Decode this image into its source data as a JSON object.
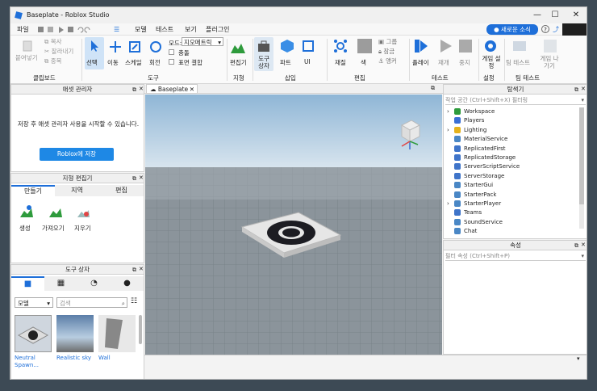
{
  "window": {
    "title": "Baseplate - Roblox Studio"
  },
  "menu": {
    "file": "파일",
    "items": [
      "모델",
      "테스트",
      "보기",
      "플러그인"
    ],
    "news_label": "새로운 소식"
  },
  "ribbon": {
    "clipboard": {
      "paste": "붙여넣기",
      "copy": "복사",
      "cut": "잘라내기",
      "duplicate": "중복",
      "group": "클립보드"
    },
    "tools": {
      "select": "선택",
      "move": "이동",
      "scale": "스케일",
      "rotate": "회전",
      "mode_label": "모드:",
      "mode_value": "지오메트릭",
      "collisions": "충돌",
      "surface_join": "표면 결합",
      "group": "도구"
    },
    "terrain": {
      "editor": "편집기",
      "group": "지형"
    },
    "insert": {
      "toolbox": "도구 상자",
      "part": "파트",
      "ui": "UI",
      "group": "삽입"
    },
    "edit": {
      "material": "재질",
      "color": "색",
      "group_item": "그룹",
      "lock": "잠금",
      "anchor": "앵커",
      "group": "편집"
    },
    "test": {
      "play": "플레이",
      "resume": "재개",
      "stop": "중지",
      "group": "테스트"
    },
    "settings": {
      "game_settings": "게임 설정",
      "group": "설정"
    },
    "team_test": {
      "team_test": "팀 테스트",
      "exit_game": "게임 나가기",
      "group": "팀 테스트"
    }
  },
  "asset_manager": {
    "title": "애셋 관리자",
    "message": "저장 후 애셋 관리자 사용을 시작할 수 있습니다.",
    "save_button": "Roblox에 저장"
  },
  "terrain_editor": {
    "title": "지형 편집기",
    "tabs": [
      "만들기",
      "지역",
      "편집"
    ],
    "tools": [
      "생성",
      "가져오기",
      "지우기"
    ]
  },
  "toolbox": {
    "title": "도구 상자",
    "category": "모델",
    "search_placeholder": "검색",
    "items": [
      "Neutral Spawn...",
      "Realistic sky",
      "Wall"
    ]
  },
  "viewport": {
    "tab": "Baseplate"
  },
  "explorer": {
    "title": "탐색기",
    "filter_placeholder": "작업 공간 (Ctrl+Shift+X) 필터링",
    "items": [
      {
        "name": "Workspace",
        "expand": true,
        "color": "#2e9b3c"
      },
      {
        "name": "Players",
        "expand": false,
        "color": "#3b6fd4"
      },
      {
        "name": "Lighting",
        "expand": true,
        "color": "#e5b21b"
      },
      {
        "name": "MaterialService",
        "expand": false,
        "color": "#4a87c5"
      },
      {
        "name": "ReplicatedFirst",
        "expand": false,
        "color": "#3f74c9"
      },
      {
        "name": "ReplicatedStorage",
        "expand": false,
        "color": "#3f74c9"
      },
      {
        "name": "ServerScriptService",
        "expand": false,
        "color": "#3f74c9"
      },
      {
        "name": "ServerStorage",
        "expand": false,
        "color": "#3f74c9"
      },
      {
        "name": "StarterGui",
        "expand": false,
        "color": "#4a87c5"
      },
      {
        "name": "StarterPack",
        "expand": false,
        "color": "#4a87c5"
      },
      {
        "name": "StarterPlayer",
        "expand": true,
        "color": "#4a87c5"
      },
      {
        "name": "Teams",
        "expand": false,
        "color": "#3f74c9"
      },
      {
        "name": "SoundService",
        "expand": false,
        "color": "#4a87c5"
      },
      {
        "name": "Chat",
        "expand": false,
        "color": "#4a87c5"
      }
    ]
  },
  "properties": {
    "title": "속성",
    "filter_placeholder": "필터 속성 (Ctrl+Shift+P)"
  }
}
